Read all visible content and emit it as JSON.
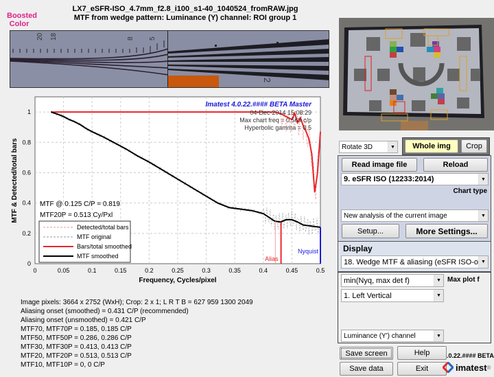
{
  "header": {
    "boosted_label": "Boosted Color",
    "filename": "LX7_eSFR-ISO_4.7mm_f2.8_i100_s1-40_1040524_fromRAW.jpg",
    "subtitle": "MTF from wedge pattern:   Luminance (Y) channel:   ROI group 1"
  },
  "crop_labels": {
    "left_numbers": [
      "20",
      "18",
      "8",
      "5"
    ],
    "right_number": "2"
  },
  "chart_data": {
    "type": "line",
    "title": "",
    "xlabel": "Frequency, Cycles/pixel",
    "ylabel": "MTF & Detected/total bars",
    "xlim": [
      0,
      0.5
    ],
    "ylim": [
      0,
      1.1
    ],
    "xticks": [
      "0",
      "0.05",
      "0.1",
      "0.15",
      "0.2",
      "0.25",
      "0.3",
      "0.35",
      "0.4",
      "0.45",
      "0.5"
    ],
    "yticks": [
      "0",
      "0.2",
      "0.4",
      "0.6",
      "0.8",
      "1"
    ],
    "grid": true,
    "legend_position": "bottom-left",
    "legend": [
      "Detected/total bars",
      "MTF original",
      "Bars/total smoothed",
      "MTF smoothed"
    ],
    "series": [
      {
        "name": "MTF smoothed",
        "color": "#000000",
        "x": [
          0.028,
          0.04,
          0.05,
          0.06,
          0.07,
          0.08,
          0.09,
          0.1,
          0.12,
          0.14,
          0.15,
          0.16,
          0.18,
          0.2,
          0.22,
          0.24,
          0.26,
          0.28,
          0.3,
          0.32,
          0.34,
          0.36,
          0.38,
          0.4,
          0.41,
          0.42,
          0.43,
          0.44,
          0.45,
          0.46,
          0.47,
          0.48,
          0.49,
          0.5
        ],
        "y": [
          1.0,
          0.985,
          0.97,
          0.95,
          0.935,
          0.915,
          0.89,
          0.87,
          0.835,
          0.795,
          0.775,
          0.755,
          0.71,
          0.67,
          0.625,
          0.58,
          0.535,
          0.49,
          0.445,
          0.4,
          0.37,
          0.36,
          0.35,
          0.33,
          0.305,
          0.28,
          0.275,
          0.29,
          0.29,
          0.275,
          0.255,
          0.25,
          0.245,
          0.24
        ]
      },
      {
        "name": "Bars/total smoothed",
        "color": "#e8262b",
        "x": [
          0.028,
          0.42,
          0.43,
          0.44,
          0.45,
          0.455,
          0.46,
          0.465,
          0.47,
          0.475,
          0.48,
          0.485,
          0.49,
          0.495,
          0.5
        ],
        "y": [
          1.0,
          1.0,
          0.99,
          0.97,
          0.95,
          0.99,
          0.93,
          0.96,
          0.91,
          0.87,
          0.82,
          0.72,
          0.47,
          0.6,
          0.87
        ]
      }
    ],
    "annotations": {
      "version": "Imatest 4.0.22.#### BETA Master",
      "date": "04-Dec-2014 15:08:29",
      "max_chart_freq": "Max chart freq = 0.569 c/p",
      "gamma": "Hyperbolic   gamma = 0.5",
      "mtf_at": "MTF @ 0.125 C/P = 0.819",
      "mtf20p": "MTF20P = 0.513 Cy/Pxl",
      "alias_label": "Alias",
      "alias_x": 0.431,
      "alias_unsmoothed_x": 0.421,
      "nyquist_label": "Nyquist",
      "nyquist_x": 0.5
    }
  },
  "info": [
    "Image pixels: 3664 x 2752 (WxH);   Crop: 2 x 1;   L R T B = 627 959 1300 2049",
    "Aliasing onset (smoothed) = 0.431 C/P (recommended)",
    "Aliasing onset (unsmoothed) = 0.421 C/P",
    "MTF70, MTF70P = 0.185, 0.185 C/P",
    "MTF50, MTF50P = 0.286, 0.286 C/P",
    "MTF30, MTF30P = 0.413, 0.413 C/P",
    "MTF20, MTF20P = 0.513, 0.513 C/P",
    "MTF10, MTF10P = 0, 0 C/P"
  ],
  "controls": {
    "rotate_select": "Rotate 3D",
    "whole_img": "Whole img",
    "crop": "Crop",
    "read_image": "Read image file",
    "reload": "Reload",
    "chart_type_select": "9. eSFR ISO  (12233:2014)",
    "chart_type_label": "Chart type",
    "analysis_select": "New analysis of the current image",
    "setup": "Setup...",
    "more_settings": "More Settings...",
    "display_label": "Display",
    "display_select": "18. Wedge MTF & aliasing (eSFR ISO-o...",
    "maxplot_select": "min(Nyq, max det f)",
    "maxplot_label": "Max plot f",
    "roi_select": "1. Left Vertical",
    "channel_select": "Luminance (Y') channel",
    "save_screen": "Save screen",
    "help": "Help",
    "save_data": "Save data",
    "exit": "Exit",
    "version": ".0.22.#### BETA",
    "brand": "imatest",
    "brand_mark": "®"
  },
  "colors": {
    "boosted": "#e0208a",
    "red": "#e8262b",
    "blue": "#1a1ad8",
    "whole_img_bg": "#ffffc0"
  }
}
